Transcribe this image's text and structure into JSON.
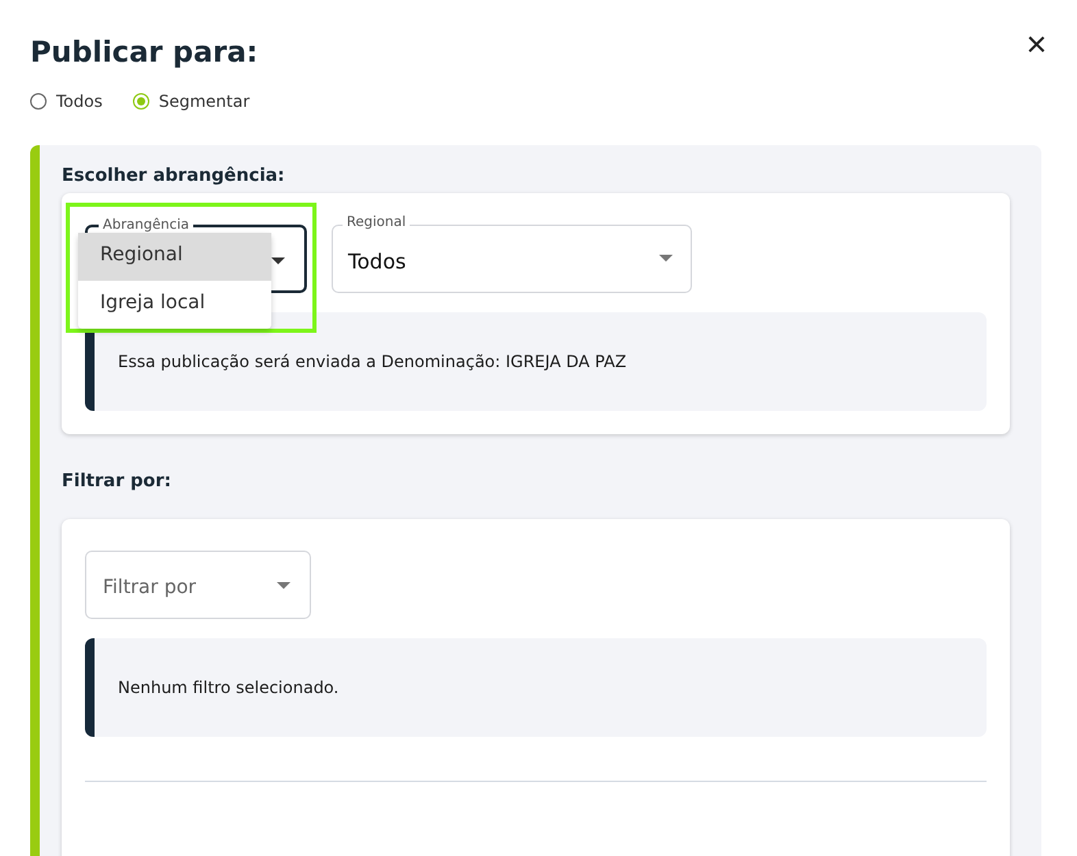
{
  "dialog": {
    "title": "Publicar para:",
    "close_label": "×"
  },
  "audience": [
    {
      "label": "Todos",
      "selected": false
    },
    {
      "label": "Segmentar",
      "selected": true
    }
  ],
  "scope_section": {
    "heading": "Escolher abrangência:",
    "scope_select": {
      "label": "Abrangência",
      "expanded": true,
      "options": [
        {
          "label": "Regional",
          "selected": true
        },
        {
          "label": "Igreja local",
          "selected": false
        }
      ]
    },
    "regional_select": {
      "label": "Regional",
      "value": "Todos"
    },
    "info": "Essa publicação será enviada a Denominação: IGREJA DA PAZ"
  },
  "filter_section": {
    "heading": "Filtrar por:",
    "filter_select": {
      "placeholder": "Filtrar por"
    },
    "info": "Nenhum filtro selecionado."
  }
}
